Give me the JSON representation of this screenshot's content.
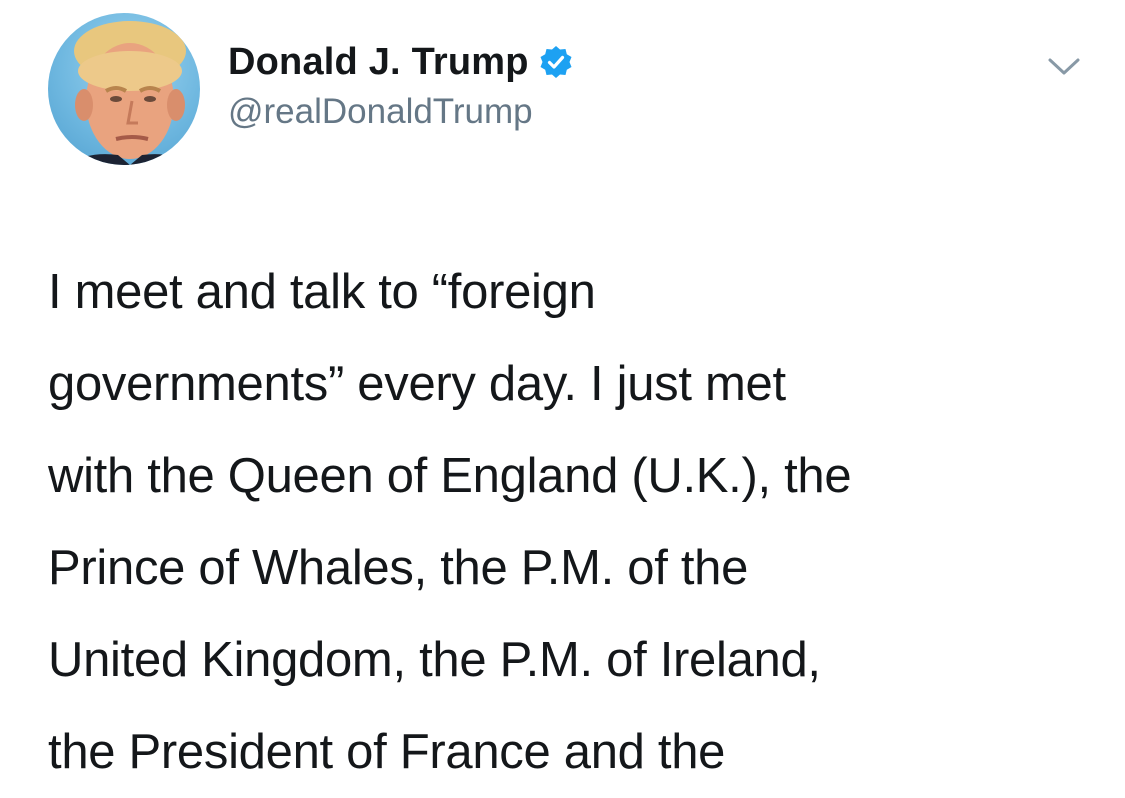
{
  "author": {
    "display_name": "Donald J. Trump",
    "handle": "@realDonaldTrump",
    "verified": true,
    "avatar_icon": "profile-photo-avatar"
  },
  "menu": {
    "caret_icon": "chevron-down-icon"
  },
  "tweet": {
    "lines": [
      "I meet and talk to “foreign",
      "governments” every day. I just met",
      "with the Queen of England (U.K.), the",
      "Prince of Whales, the P.M. of the",
      "United Kingdom, the P.M. of Ireland,",
      "the President of France and the"
    ]
  },
  "colors": {
    "text": "#14171a",
    "secondary_text": "#657786",
    "verified_blue": "#1da1f2",
    "caret": "#8899a6"
  }
}
